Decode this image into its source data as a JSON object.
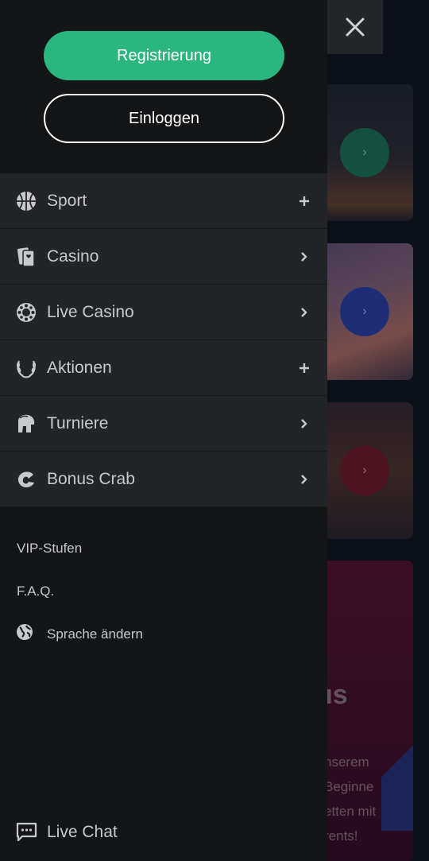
{
  "auth": {
    "register_label": "Registrierung",
    "login_label": "Einloggen"
  },
  "menu": [
    {
      "label": "Sport",
      "icon": "basketball-icon",
      "action": "plus"
    },
    {
      "label": "Casino",
      "icon": "cards-icon",
      "action": "chevron"
    },
    {
      "label": "Live Casino",
      "icon": "poker-chip-icon",
      "action": "chevron"
    },
    {
      "label": "Aktionen",
      "icon": "laurel-icon",
      "action": "plus"
    },
    {
      "label": "Turniere",
      "icon": "spartan-helmet-icon",
      "action": "chevron"
    },
    {
      "label": "Bonus Crab",
      "icon": "crab-claw-icon",
      "action": "chevron"
    }
  ],
  "links": {
    "vip": "VIP-Stufen",
    "faq": "F.A.Q.",
    "language": "Sprache ändern"
  },
  "live_chat": "Live Chat",
  "background": {
    "promo_heading_fragment": "us",
    "promo_text_lines": [
      "nserem",
      "Beginne",
      "etten mit",
      "rents!"
    ]
  },
  "colors": {
    "accent": "#2bb67f",
    "drawer_bg": "#141517",
    "menu_bg": "#232427",
    "text": "#c7c9cc"
  }
}
